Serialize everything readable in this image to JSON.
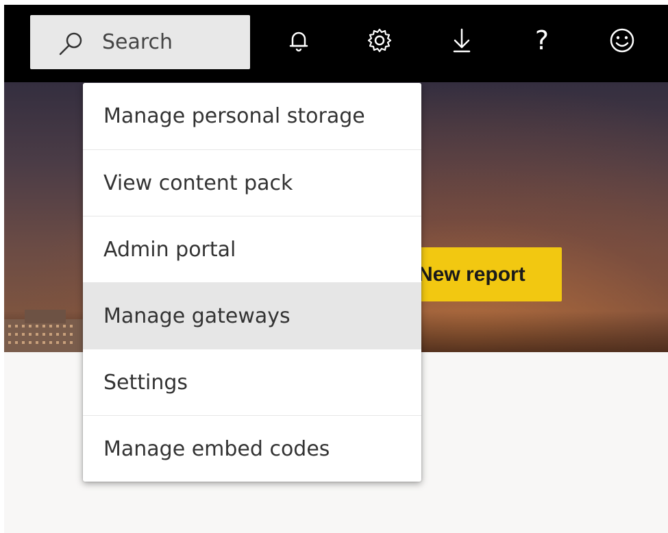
{
  "search": {
    "placeholder": "Search"
  },
  "header_icons": [
    {
      "name": "notifications",
      "icon": "bell-icon"
    },
    {
      "name": "settings",
      "icon": "gear-icon"
    },
    {
      "name": "download",
      "icon": "download-icon"
    },
    {
      "name": "help",
      "icon": "question-icon",
      "glyph": "?"
    },
    {
      "name": "feedback",
      "icon": "smiley-icon"
    }
  ],
  "hero": {
    "new_report_label": "New report"
  },
  "settings_menu": {
    "items": [
      {
        "label": "Manage personal storage"
      },
      {
        "label": "View content pack"
      },
      {
        "label": "Admin portal"
      },
      {
        "label": "Manage gateways",
        "highlighted": true
      },
      {
        "label": "Settings"
      },
      {
        "label": "Manage embed codes"
      }
    ]
  },
  "colors": {
    "topbar": "#000000",
    "accent": "#f2c811",
    "menu_hover": "#e6e6e6"
  }
}
